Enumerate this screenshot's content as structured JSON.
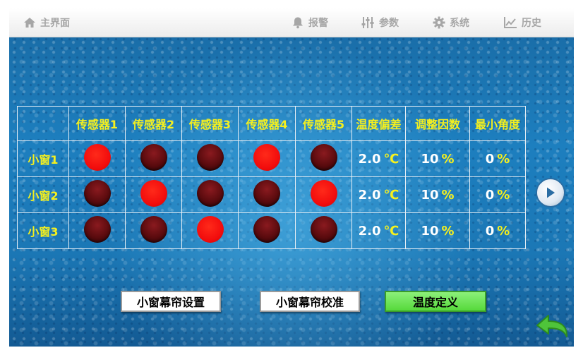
{
  "nav": {
    "home": "主界面",
    "alarm": "报警",
    "params": "参数",
    "system": "系统",
    "history": "历史"
  },
  "table": {
    "headers": [
      "",
      "传感器1",
      "传感器2",
      "传感器3",
      "传感器4",
      "传感器5",
      "温度偏差",
      "调整因数",
      "最小角度"
    ],
    "rows": [
      {
        "label": "小窗1",
        "sensors": [
          true,
          false,
          false,
          true,
          false
        ],
        "temp_dev": "2.0",
        "temp_unit": "℃",
        "factor": "10",
        "factor_unit": "%",
        "min_angle": "0",
        "angle_unit": "%"
      },
      {
        "label": "小窗2",
        "sensors": [
          false,
          true,
          false,
          false,
          true
        ],
        "temp_dev": "2.0",
        "temp_unit": "℃",
        "factor": "10",
        "factor_unit": "%",
        "min_angle": "0",
        "angle_unit": "%"
      },
      {
        "label": "小窗3",
        "sensors": [
          false,
          false,
          true,
          false,
          false
        ],
        "temp_dev": "2.0",
        "temp_unit": "℃",
        "factor": "10",
        "factor_unit": "%",
        "min_angle": "0",
        "angle_unit": "%"
      }
    ]
  },
  "buttons": {
    "curtain_setup": "小窗幕帘设置",
    "curtain_calibrate": "小窗幕帘校准",
    "temp_define": "温度定义"
  },
  "colors": {
    "sensor_on": "#f20d0d",
    "sensor_off": "#5a0b0e",
    "label_yellow": "#f5f01e",
    "active_button": "#56d93b"
  }
}
